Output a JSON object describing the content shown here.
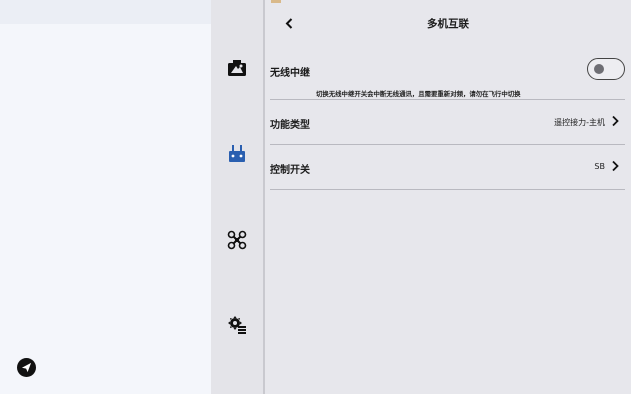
{
  "header": {
    "title": "多机互联",
    "back_icon": "chevron-left-icon"
  },
  "settings": {
    "wireless_relay": {
      "label": "无线中继",
      "enabled": false,
      "hint": "切换无线中继开关会中断无线通讯，且需要重新对频，请勿在飞行中切换"
    },
    "function_type": {
      "label": "功能类型",
      "value": "遥控接力-主机"
    },
    "control_switch": {
      "label": "控制开关",
      "value": "SB"
    }
  },
  "rail": {
    "items": [
      {
        "icon": "camera-icon"
      },
      {
        "icon": "remote-controller-icon"
      },
      {
        "icon": "drone-icon"
      },
      {
        "icon": "gear-settings-icon"
      }
    ]
  },
  "left_panel": {
    "fab_icon": "send-icon"
  },
  "colors": {
    "background": "#e7e7ec",
    "left_panel": "#f4f6fb",
    "divider": "#b9b9c0",
    "accent": "#d9b98a"
  }
}
